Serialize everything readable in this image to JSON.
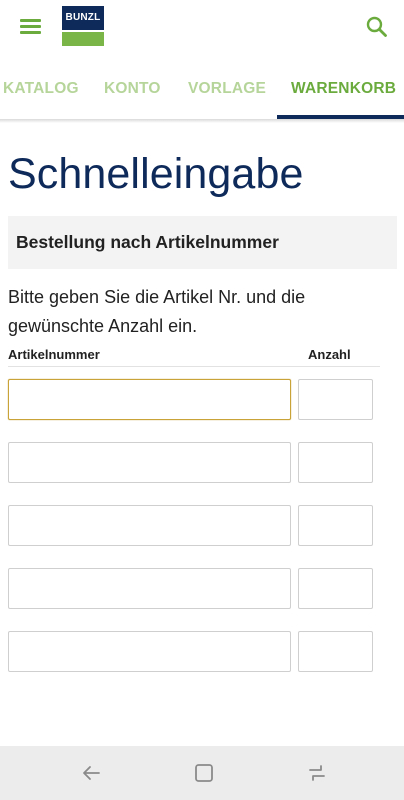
{
  "header": {
    "logo_text": "BUNZL",
    "menu_icon": "hamburger-menu-icon",
    "search_icon": "search-icon",
    "colors": {
      "green": "#6bab3e",
      "light_green": "#b6d59a",
      "navy": "#0e2a5a"
    }
  },
  "tabs": [
    {
      "label": "KATALOG",
      "active": false
    },
    {
      "label": "KONTO",
      "active": false
    },
    {
      "label": "VORLAGE",
      "active": false
    },
    {
      "label": "WARENKORB",
      "active": true
    }
  ],
  "main": {
    "title": "Schnelleingabe",
    "section_title": "Bestellung nach Artikelnummer",
    "intro": "Bitte geben Sie die Artikel Nr. und die gewünschte Anzahl ein.",
    "columns": {
      "article": "Artikelnummer",
      "quantity": "Anzahl"
    },
    "rows": [
      {
        "article": "",
        "quantity": "",
        "focused": true
      },
      {
        "article": "",
        "quantity": "",
        "focused": false
      },
      {
        "article": "",
        "quantity": "",
        "focused": false
      },
      {
        "article": "",
        "quantity": "",
        "focused": false
      },
      {
        "article": "",
        "quantity": "",
        "focused": false
      }
    ]
  },
  "system_nav": {
    "back_icon": "back-arrow-icon",
    "home_icon": "home-square-icon",
    "recents_icon": "recent-apps-icon"
  }
}
